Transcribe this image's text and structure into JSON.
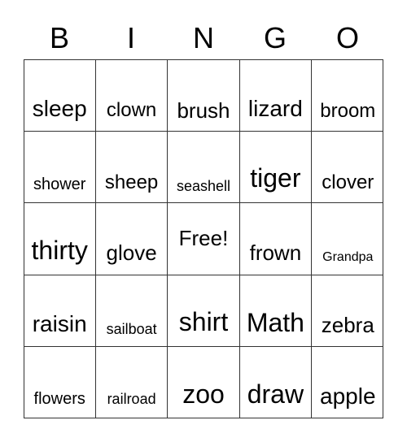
{
  "header": [
    "B",
    "I",
    "N",
    "G",
    "O"
  ],
  "cells": [
    [
      "sleep",
      "clown",
      "brush",
      "lizard",
      "broom"
    ],
    [
      "shower",
      "sheep",
      "seashell",
      "tiger",
      "clover"
    ],
    [
      "thirty",
      "glove",
      "Free!",
      "frown",
      "Grandpa"
    ],
    [
      "raisin",
      "sailboat",
      "shirt",
      "Math",
      "zebra"
    ],
    [
      "flowers",
      "railroad",
      "zoo",
      "draw",
      "apple"
    ]
  ]
}
